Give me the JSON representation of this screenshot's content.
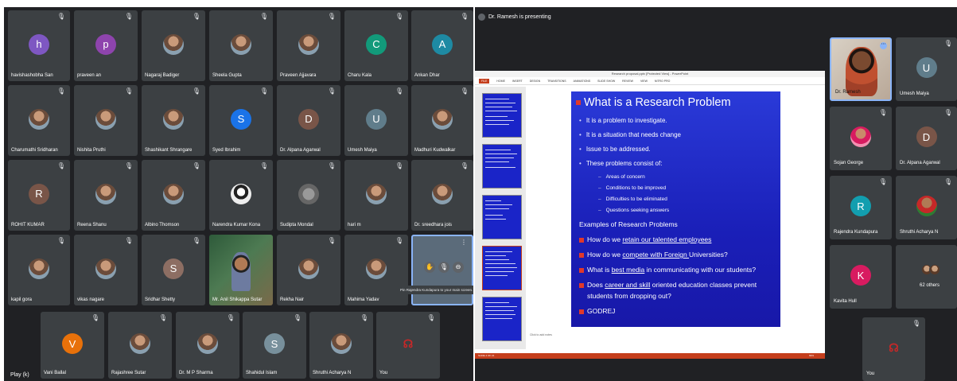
{
  "grid": {
    "tiles": [
      {
        "name": "havishashobha San",
        "initial": "h",
        "color": "#7e57c2"
      },
      {
        "name": "praveen an",
        "initial": "p",
        "color": "#8e44ad"
      },
      {
        "name": "Nagaraj Badiger",
        "initial": "",
        "color": ""
      },
      {
        "name": "Sheela Gupta",
        "initial": "",
        "color": ""
      },
      {
        "name": "Praveen Ajjavara",
        "initial": "",
        "color": ""
      },
      {
        "name": "Charu Kala",
        "initial": "C",
        "color": "#129a7a"
      },
      {
        "name": "Ankan Dhar",
        "initial": "A",
        "color": "#1e8aa3"
      },
      {
        "name": "Charumathi Sridharan",
        "initial": "",
        "color": ""
      },
      {
        "name": "Nishita Pruthi",
        "initial": "",
        "color": ""
      },
      {
        "name": "Shashikant Shrangare",
        "initial": "",
        "color": ""
      },
      {
        "name": "Syed Ibrahim",
        "initial": "S",
        "color": "#1a73e8"
      },
      {
        "name": "Dr. Alpana Agarwal",
        "initial": "D",
        "color": "#795548"
      },
      {
        "name": "Umesh Maiya",
        "initial": "U",
        "color": "#607d8b"
      },
      {
        "name": "Madhuri Kudwalkar",
        "initial": "",
        "color": ""
      },
      {
        "name": "ROHIT KUMAR",
        "initial": "R",
        "color": "#795548"
      },
      {
        "name": "Reena Shanu",
        "initial": "",
        "color": ""
      },
      {
        "name": "Albino Thomson",
        "initial": "",
        "color": ""
      },
      {
        "name": "Narendra Kumar Kona",
        "initial": "",
        "color": ""
      },
      {
        "name": "Sudipta Mondal",
        "initial": "",
        "color": ""
      },
      {
        "name": "hari m",
        "initial": "",
        "color": ""
      },
      {
        "name": "Dr. sreedhara jois",
        "initial": "",
        "color": ""
      },
      {
        "name": "kapil gora",
        "initial": "",
        "color": ""
      },
      {
        "name": "vikas nagare",
        "initial": "",
        "color": ""
      },
      {
        "name": "Sridhar Shetty",
        "initial": "S",
        "color": "#8d6e63"
      },
      {
        "name": "Mr. Anil Shikappa Sutar",
        "initial": "",
        "color": ""
      },
      {
        "name": "Rekha Nair",
        "initial": "",
        "color": ""
      },
      {
        "name": "Mahima Yadav",
        "initial": "",
        "color": ""
      }
    ],
    "bottom_row": [
      {
        "name": "Vani Ballal",
        "initial": "V",
        "color": "#e8710a"
      },
      {
        "name": "Rajashree Sutar",
        "initial": "",
        "color": ""
      },
      {
        "name": "Dr. M P Sharma",
        "initial": "",
        "color": ""
      },
      {
        "name": "Shahidul Islam",
        "initial": "S",
        "color": "#78909c"
      },
      {
        "name": "Shruthi Acharya N",
        "initial": "",
        "color": ""
      },
      {
        "name": "You",
        "initial": "",
        "color": ""
      }
    ],
    "tooltip": "Pin Rajendra Kundapura to your main screen.",
    "play_label": "Play (k)"
  },
  "presentation": {
    "presenting_label": "Dr. Ramesh is presenting",
    "window_title": "Research proposal.pptx [Protected View] - PowerPoint",
    "ribbon_tabs": [
      "FILE",
      "HOME",
      "INSERT",
      "DESIGN",
      "TRANSITIONS",
      "ANIMATIONS",
      "SLIDE SHOW",
      "REVIEW",
      "VIEW",
      "NITRO PRO"
    ],
    "slide": {
      "title": "What is a Research Problem",
      "bullets": [
        "It is a problem  to investigate.",
        "It is a situation that needs change",
        "Issue to be addressed.",
        "These problems consist of:"
      ],
      "sub_bullets": [
        "Areas of concern",
        "Conditions to be improved",
        "Difficulties to be eliminated",
        "Questions seeking answers"
      ],
      "examples_heading": "Examples of Research Problems",
      "questions": [
        {
          "pre": "How do we ",
          "u": "retain our talented employees",
          "post": ""
        },
        {
          "pre": "How do we ",
          "u": "compete with Foreign ",
          "post": "Universities?"
        },
        {
          "pre": "What  is ",
          "u": "best media",
          "post": " in communicating with our students?"
        },
        {
          "pre": "Does ",
          "u": "career and skill",
          "post": " oriented education classes prevent"
        }
      ],
      "question_continuation": "students from dropping out?",
      "last_item": "GODREJ"
    },
    "notes_placeholder": "Click to add notes",
    "status_left": "SLIDE 4 OF 21",
    "status_right": "69%"
  },
  "side_tiles": [
    {
      "name": "Dr. Ramesh",
      "initial": "",
      "color": ""
    },
    {
      "name": "Umesh Maiya",
      "initial": "U",
      "color": "#607d8b"
    },
    {
      "name": "Sojan George",
      "initial": "",
      "color": ""
    },
    {
      "name": "Dr. Alpana Agarwal",
      "initial": "D",
      "color": "#795548"
    },
    {
      "name": "Rajendra Kundapura",
      "initial": "R",
      "color": "#129eaf"
    },
    {
      "name": "Shruthi Acharya N",
      "initial": "",
      "color": ""
    },
    {
      "name": "Kavita Hull",
      "initial": "K",
      "color": "#d81b60"
    },
    {
      "name": "62 others",
      "initial": "",
      "color": ""
    },
    {
      "name": "You",
      "initial": "",
      "color": ""
    }
  ]
}
